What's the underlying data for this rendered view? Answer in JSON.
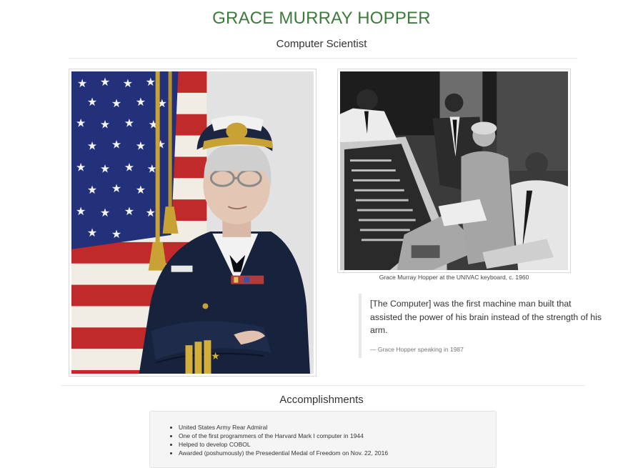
{
  "header": {
    "title": "GRACE MURRAY HOPPER",
    "subtitle": "Computer Scientist"
  },
  "images": {
    "portrait": {
      "name": "portrait-photo"
    },
    "univac": {
      "name": "univac-photo"
    }
  },
  "caption": "Grace Murray Hopper at the UNIVAC keyboard, c. 1960",
  "quote": {
    "text": "[The Computer] was the first machine man built that assisted the power of his brain instead of the strength of his arm.",
    "source": "— Grace Hopper speaking in 1987"
  },
  "accomplishments": {
    "heading": "Accomplishments",
    "items": [
      "United States Army Rear Admiral",
      "One of the first programmers of the Harvard Mark I computer in 1944",
      "Helped to develop COBOL",
      "Awarded (poshumously) the Presedential Medal of Freedom on Nov. 22, 2016"
    ]
  },
  "colors": {
    "title": "#3d7a3c",
    "panel": "#f5f5f5",
    "quote_border": "#e8e8e8"
  }
}
